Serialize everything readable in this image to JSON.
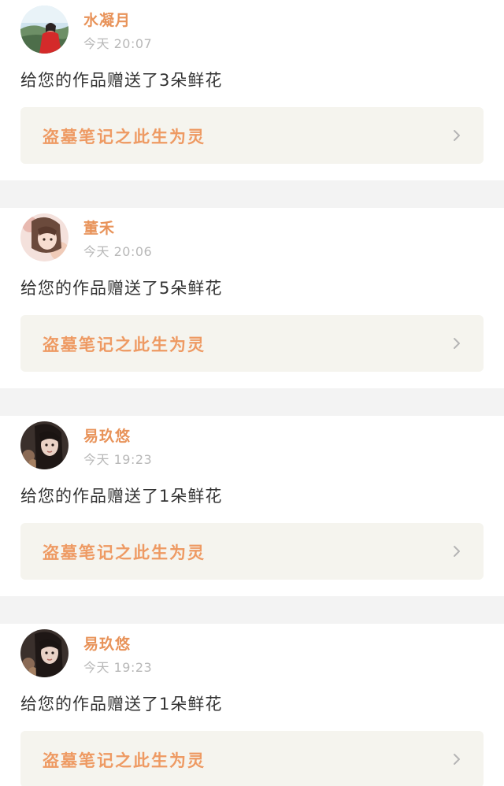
{
  "notifications": [
    {
      "username": "水凝月",
      "time": "今天 20:07",
      "message": "给您的作品赠送了3朵鲜花",
      "work_title": "盗墓笔记之此生为灵",
      "avatar": "avatar-landscape-red"
    },
    {
      "username": "董禾",
      "time": "今天 20:06",
      "message": "给您的作品赠送了5朵鲜花",
      "work_title": "盗墓笔记之此生为灵",
      "avatar": "avatar-anime-girl"
    },
    {
      "username": "易玖悠",
      "time": "今天 19:23",
      "message": "给您的作品赠送了1朵鲜花",
      "work_title": "盗墓笔记之此生为灵",
      "avatar": "avatar-dark-portrait"
    },
    {
      "username": "易玖悠",
      "time": "今天 19:23",
      "message": "给您的作品赠送了1朵鲜花",
      "work_title": "盗墓笔记之此生为灵",
      "avatar": "avatar-dark-portrait"
    }
  ],
  "colors": {
    "username": "#e8935a",
    "work_title": "#ee9a63",
    "time": "#b8b8b8",
    "message": "#333333",
    "link_bg": "#f5f4ee",
    "page_bg": "#f3f3f3"
  },
  "icons": {
    "chevron": "chevron-right-icon"
  }
}
